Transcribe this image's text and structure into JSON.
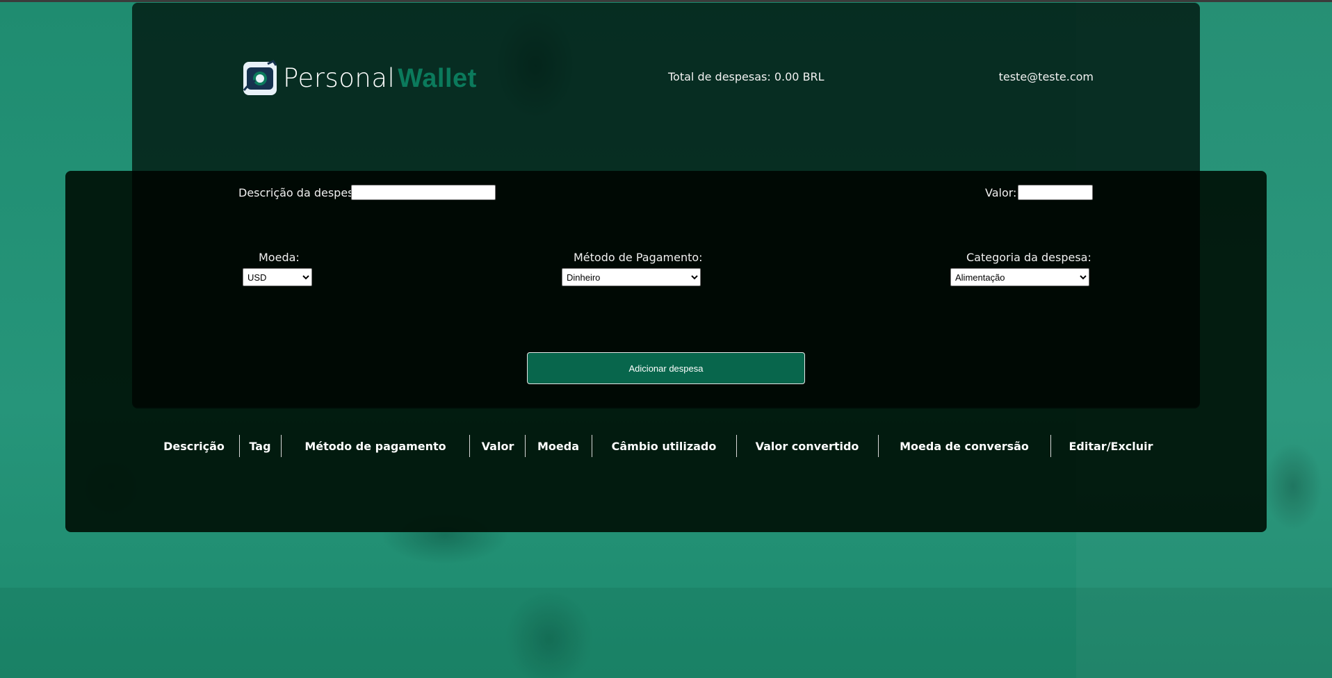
{
  "header": {
    "logo_text": "Personal",
    "logo_accent": "Wallet",
    "total_label": "Total de despesas:",
    "total_value": "0.00",
    "total_currency": "BRL",
    "email": "teste@teste.com"
  },
  "form": {
    "description_label": "Descrição da despesa:",
    "description_value": "",
    "value_label": "Valor:",
    "value_value": "",
    "currency_label": "Moeda:",
    "currency_selected": "USD",
    "payment_label": "Método de Pagamento:",
    "payment_selected": "Dinheiro",
    "category_label": "Categoria da despesa:",
    "category_selected": "Alimentação",
    "submit_label": "Adicionar despesa"
  },
  "table": {
    "headers": [
      "Descrição",
      "Tag",
      "Método de pagamento",
      "Valor",
      "Moeda",
      "Câmbio utilizado",
      "Valor convertido",
      "Moeda de conversão",
      "Editar/Excluir"
    ],
    "rows": []
  },
  "colors": {
    "background": "#238f74",
    "accent": "#0b7a5c",
    "button": "#08664c",
    "panel": "#001208"
  },
  "icons": {
    "logo": "wallet-logo-icon"
  }
}
